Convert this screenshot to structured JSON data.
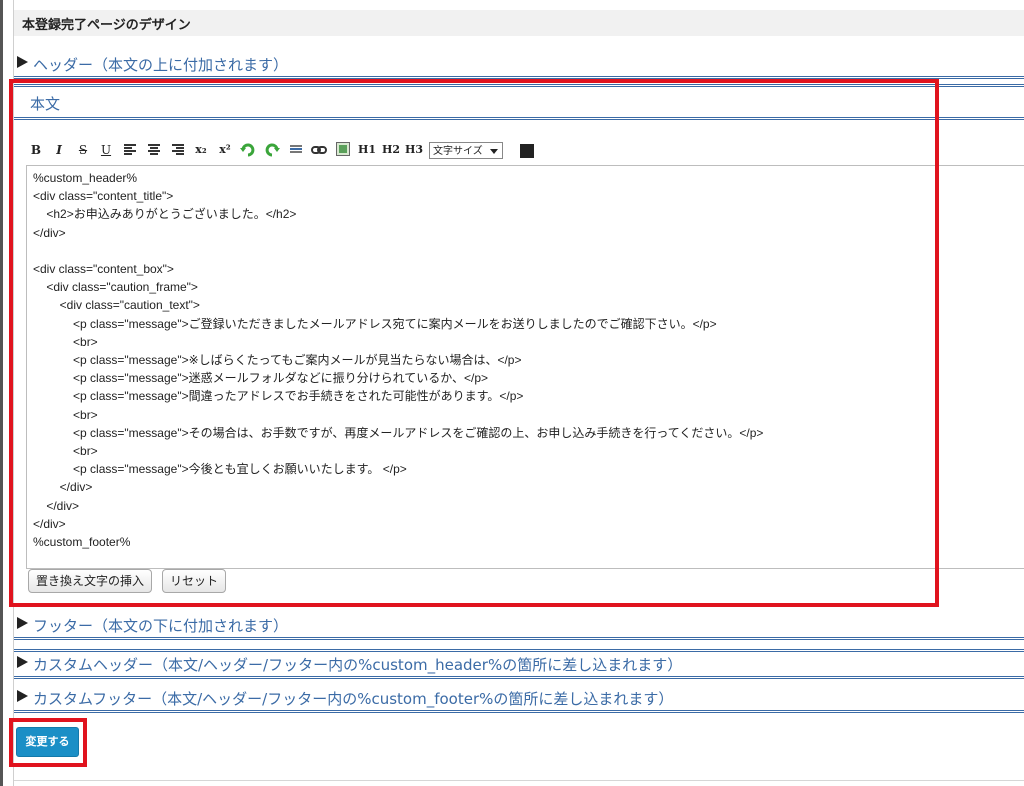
{
  "page": {
    "title": "本登録完了ページのデザイン"
  },
  "sections": {
    "header_label": "ヘッダー（本文の上に付加されます）",
    "body_label": "本文",
    "footer_label": "フッター（本文の下に付加されます）",
    "custom_header_label": "カスタムヘッダー（本文/ヘッダー/フッター内の%custom_header%の箇所に差し込まれます）",
    "custom_footer_label": "カスタムフッター（本文/ヘッダー/フッター内の%custom_footer%の箇所に差し込まれます）"
  },
  "toolbar": {
    "bold": "B",
    "italic": "I",
    "strike": "S",
    "underline": "U",
    "subscript": "x₂",
    "superscript": "x²",
    "h1": "H1",
    "h2": "H2",
    "h3": "H3",
    "font_size": "文字サイズ",
    "text_color": "#222222"
  },
  "editor": {
    "content": "%custom_header%\n<div class=\"content_title\">\n    <h2>お申込みありがとうございました。</h2>\n</div>\n\n<div class=\"content_box\">\n    <div class=\"caution_frame\">\n        <div class=\"caution_text\">\n            <p class=\"message\">ご登録いただきましたメールアドレス宛てに案内メールをお送りしましたのでご確認下さい。</p>\n            <br>\n            <p class=\"message\">※しばらくたってもご案内メールが見当たらない場合は、</p>\n            <p class=\"message\">迷惑メールフォルダなどに振り分けられているか、</p>\n            <p class=\"message\">間違ったアドレスでお手続きをされた可能性があります。</p>\n            <br>\n            <p class=\"message\">その場合は、お手数ですが、再度メールアドレスをご確認の上、お申し込み手続きを行ってください。</p>\n            <br>\n            <p class=\"message\">今後とも宜しくお願いいたします。 </p>\n        </div>\n    </div>\n</div>\n%custom_footer%"
  },
  "buttons": {
    "insert_placeholder": "置き換え文字の挿入",
    "reset": "リセット",
    "submit": "変更する"
  },
  "colors": {
    "accent": "#3b6ba6",
    "highlight": "#e0131e",
    "submit": "#1b8fc6"
  }
}
